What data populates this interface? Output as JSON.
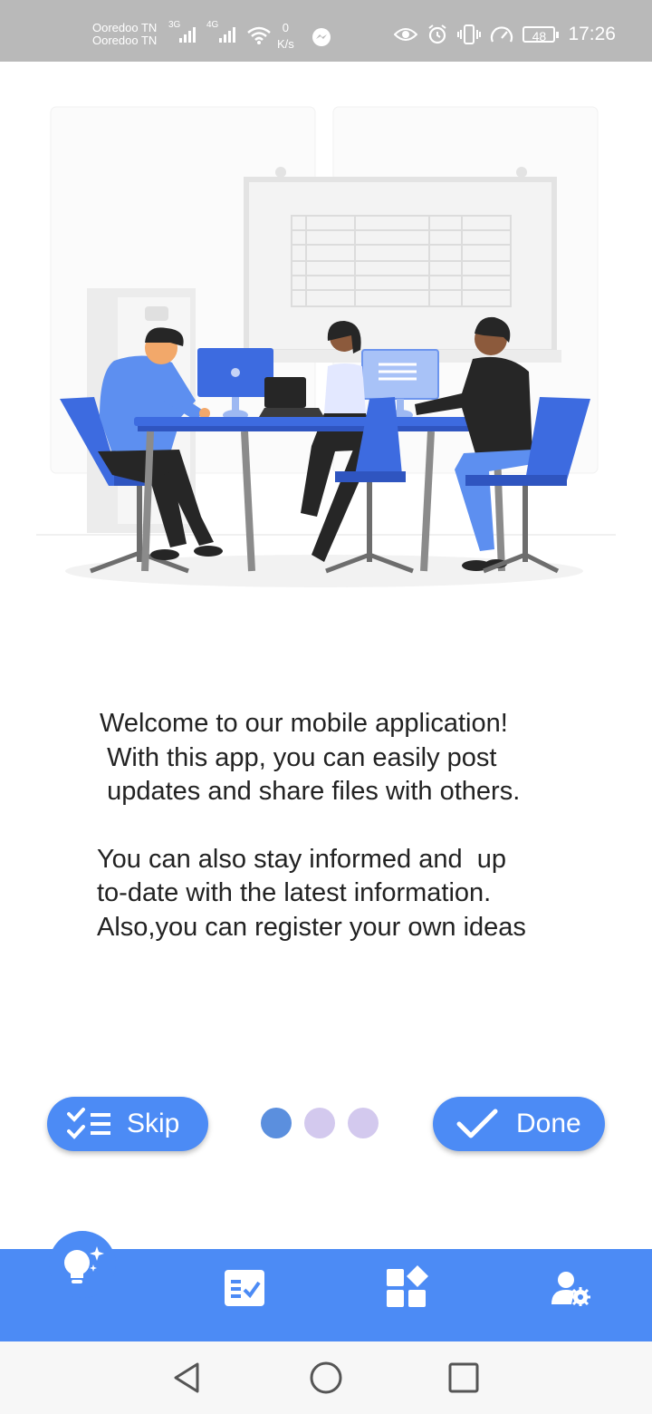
{
  "status_bar": {
    "carrier_1": "Ooredoo TN",
    "carrier_2": "Ooredoo TN",
    "network_1": "3G",
    "network_2": "4G",
    "speed_value": "0",
    "speed_unit": "K/s",
    "battery": "48",
    "time": "17:26",
    "icons": [
      "signal-icon",
      "wifi-icon",
      "messenger-icon",
      "eye-icon",
      "alarm-icon",
      "vibrate-icon",
      "speedometer-icon",
      "battery-icon"
    ]
  },
  "illustration": {
    "name": "team-working-illustration"
  },
  "intro": {
    "paragraph_1": "Welcome to our mobile application!\n With this app, you can easily post\n updates and share files with others.",
    "paragraph_2": "You can also stay informed and  up\nto-date with the latest information.\nAlso,you can register your own ideas"
  },
  "controls": {
    "skip_label": "Skip",
    "done_label": "Done",
    "pages_total": 3,
    "page_current": 1
  },
  "bottom_nav": {
    "items": [
      "idea-icon",
      "checklist-icon",
      "apps-icon",
      "user-settings-icon"
    ],
    "selected": "idea-icon"
  },
  "system_nav": {
    "items": [
      "back-icon",
      "home-icon",
      "recents-icon"
    ]
  },
  "colors": {
    "accent": "#4c8bf5",
    "dot_active": "#5b8fde",
    "dot_inactive": "#d3c9ee",
    "status_bar": "#b9b9b9"
  }
}
